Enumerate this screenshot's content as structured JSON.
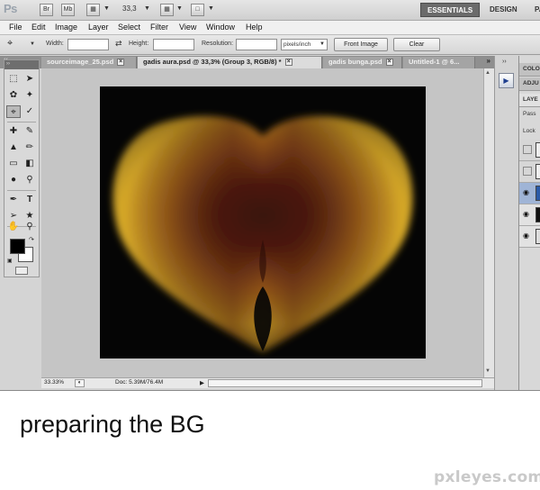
{
  "app": {
    "logo": "Ps",
    "title_icons": [
      "Br",
      "Mb"
    ],
    "zoom_value": "33,3",
    "workspaces": [
      "ESSENTIALS",
      "DESIGN",
      "PAI"
    ]
  },
  "menu": [
    "File",
    "Edit",
    "Image",
    "Layer",
    "Select",
    "Filter",
    "View",
    "Window",
    "Help"
  ],
  "options": {
    "width_label": "Width:",
    "width_value": "",
    "height_label": "Height:",
    "height_value": "",
    "resolution_label": "Resolution:",
    "resolution_value": "",
    "units": "pixels/inch",
    "front_image_label": "Front Image",
    "clear_label": "Clear"
  },
  "tabs": [
    {
      "label": "sourceimage_25.psd"
    },
    {
      "label": "gadis aura.psd @ 33,3% (Group 3, RGB/8) *",
      "active": true
    },
    {
      "label": "gadis bunga.psd"
    },
    {
      "label": "Untitled-1 @ 6..."
    }
  ],
  "tabs_more": "»",
  "status": {
    "zoom": "33.33%",
    "doc": "Doc: 5.39M/76.4M"
  },
  "panels": {
    "color_tab": "COLO",
    "adjust_tab": "ADJU",
    "layers_tab": "LAYE",
    "blend_mode": "Pass",
    "lock_label": "Lock"
  },
  "image": {
    "colors": {
      "background": "#050505",
      "outer_gold": "#e2b22b",
      "mid_amber": "#b06a1f",
      "inner_maroon": "#5a1f14"
    }
  },
  "caption": "preparing the BG",
  "watermark": "pxleyes.com"
}
